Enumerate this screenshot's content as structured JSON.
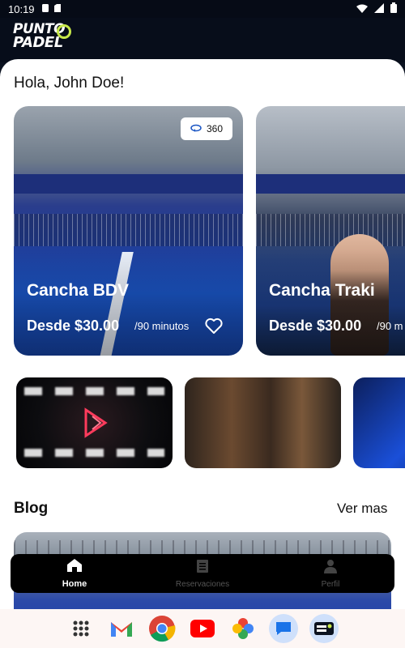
{
  "status_bar": {
    "time": "10:19"
  },
  "header": {
    "logo_line1": "PUNTO",
    "logo_line2": "PADEL"
  },
  "greeting": "Hola, John Doe!",
  "courts": [
    {
      "name": "Cancha BDV",
      "price": "Desde $30.00",
      "duration": "/90 minutos",
      "badge": "360"
    },
    {
      "name": "Cancha Traki",
      "price": "Desde $30.00",
      "duration": "/90 m"
    }
  ],
  "blog": {
    "title": "Blog",
    "see_more": "Ver mas"
  },
  "bottom_nav": [
    {
      "label": "Home",
      "icon": "home-icon",
      "active": true
    },
    {
      "label": "Reservaciones",
      "icon": "receipt-icon",
      "active": false
    },
    {
      "label": "Perfil",
      "icon": "person-icon",
      "active": false
    }
  ],
  "dock_apps": [
    "apps-grid-icon",
    "gmail-icon",
    "chrome-icon",
    "youtube-icon",
    "photos-icon",
    "messages-icon",
    "punto-padel-app-icon"
  ],
  "colors": {
    "accent": "#c7e84a",
    "header_bg": "#070d1a",
    "nav_bg": "#000000",
    "court_blue": "#1a55c4"
  }
}
